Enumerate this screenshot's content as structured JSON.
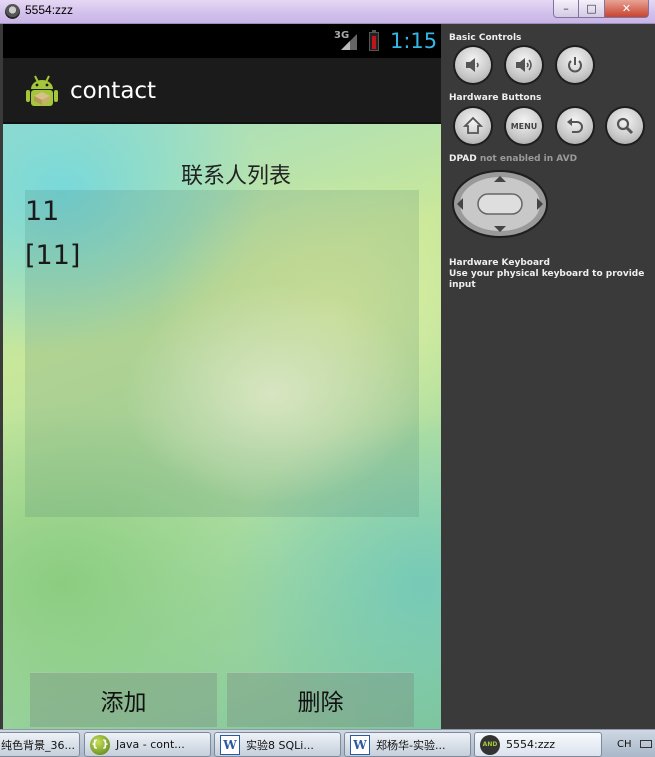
{
  "window": {
    "title": "5554:zzz",
    "minimize_glyph": "–",
    "maximize_glyph": "□",
    "close_glyph": "✕"
  },
  "status_bar": {
    "network": "3G",
    "clock": "1:15"
  },
  "action_bar": {
    "app_title": "contact",
    "icon": "android-app-icon"
  },
  "main": {
    "heading": "联系人列表",
    "list_items": [
      "11",
      "[11]"
    ],
    "add_button": "添加",
    "delete_button": "删除"
  },
  "controls": {
    "basic_label": "Basic Controls",
    "hardware_label": "Hardware Buttons",
    "menu_label": "MENU",
    "dpad_label": "DPAD",
    "dpad_note": "not enabled in AVD",
    "keyboard_label": "Hardware Keyboard",
    "keyboard_note": "Use your physical keyboard to provide input"
  },
  "taskbar": {
    "items": [
      {
        "label": "纯色背景_36...",
        "icon": "image-icon"
      },
      {
        "label": "Java - cont...",
        "icon": "eclipse-java-icon"
      },
      {
        "label": "实验8  SQLi...",
        "icon": "word-doc-icon"
      },
      {
        "label": "郑杨华-实验...",
        "icon": "word-doc-icon"
      },
      {
        "label": "5554:zzz",
        "icon": "android-emulator-icon"
      }
    ],
    "word_glyph": "W",
    "java_glyph": "{ }",
    "android_glyph": "AND",
    "tray_lang": "CH"
  },
  "colors": {
    "clock": "#33b5e5",
    "battery": "#c0141b",
    "action_bar": "#1b1b1b"
  }
}
